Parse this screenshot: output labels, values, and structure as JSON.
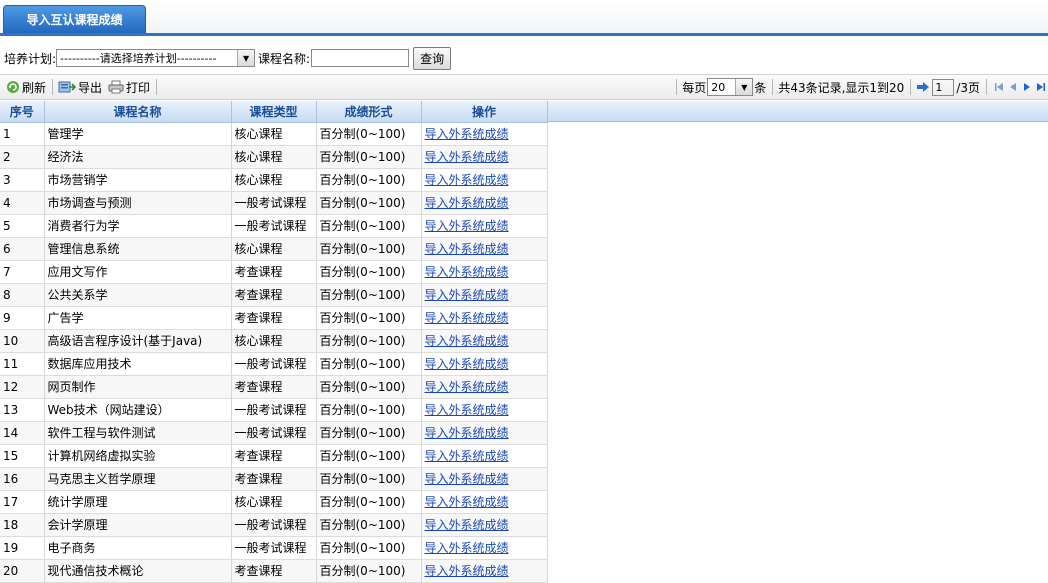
{
  "tab": {
    "label": "导入互认课程成绩"
  },
  "filter": {
    "plan_label": "培养计划:",
    "plan_value": "----------请选择培养计划----------",
    "course_label": "课程名称:",
    "course_value": "",
    "query_button": "查询"
  },
  "toolbar": {
    "refresh": "刷新",
    "export": "导出",
    "print": "打印"
  },
  "pager": {
    "per_page_label": "每页",
    "per_page_value": "20",
    "per_page_unit": "条",
    "summary": "共43条记录,显示1到20",
    "page_value": "1",
    "page_total": "/3页"
  },
  "table": {
    "headers": [
      "序号",
      "课程名称",
      "课程类型",
      "成绩形式",
      "操作"
    ],
    "rows": [
      {
        "idx": "1",
        "name": "管理学",
        "type": "核心课程",
        "form": "百分制(0~100)",
        "action": "导入外系统成绩"
      },
      {
        "idx": "2",
        "name": "经济法",
        "type": "核心课程",
        "form": "百分制(0~100)",
        "action": "导入外系统成绩"
      },
      {
        "idx": "3",
        "name": "市场营销学",
        "type": "核心课程",
        "form": "百分制(0~100)",
        "action": "导入外系统成绩"
      },
      {
        "idx": "4",
        "name": "市场调查与预测",
        "type": "一般考试课程",
        "form": "百分制(0~100)",
        "action": "导入外系统成绩"
      },
      {
        "idx": "5",
        "name": "消费者行为学",
        "type": "一般考试课程",
        "form": "百分制(0~100)",
        "action": "导入外系统成绩"
      },
      {
        "idx": "6",
        "name": "管理信息系统",
        "type": "核心课程",
        "form": "百分制(0~100)",
        "action": "导入外系统成绩"
      },
      {
        "idx": "7",
        "name": "应用文写作",
        "type": "考查课程",
        "form": "百分制(0~100)",
        "action": "导入外系统成绩"
      },
      {
        "idx": "8",
        "name": "公共关系学",
        "type": "考查课程",
        "form": "百分制(0~100)",
        "action": "导入外系统成绩"
      },
      {
        "idx": "9",
        "name": "广告学",
        "type": "考查课程",
        "form": "百分制(0~100)",
        "action": "导入外系统成绩"
      },
      {
        "idx": "10",
        "name": "高级语言程序设计(基于Java)",
        "type": "核心课程",
        "form": "百分制(0~100)",
        "action": "导入外系统成绩"
      },
      {
        "idx": "11",
        "name": "数据库应用技术",
        "type": "一般考试课程",
        "form": "百分制(0~100)",
        "action": "导入外系统成绩"
      },
      {
        "idx": "12",
        "name": "网页制作",
        "type": "考查课程",
        "form": "百分制(0~100)",
        "action": "导入外系统成绩"
      },
      {
        "idx": "13",
        "name": "Web技术（网站建设）",
        "type": "一般考试课程",
        "form": "百分制(0~100)",
        "action": "导入外系统成绩"
      },
      {
        "idx": "14",
        "name": "软件工程与软件测试",
        "type": "一般考试课程",
        "form": "百分制(0~100)",
        "action": "导入外系统成绩"
      },
      {
        "idx": "15",
        "name": "计算机网络虚拟实验",
        "type": "考查课程",
        "form": "百分制(0~100)",
        "action": "导入外系统成绩"
      },
      {
        "idx": "16",
        "name": "马克思主义哲学原理",
        "type": "考查课程",
        "form": "百分制(0~100)",
        "action": "导入外系统成绩"
      },
      {
        "idx": "17",
        "name": "统计学原理",
        "type": "核心课程",
        "form": "百分制(0~100)",
        "action": "导入外系统成绩"
      },
      {
        "idx": "18",
        "name": "会计学原理",
        "type": "一般考试课程",
        "form": "百分制(0~100)",
        "action": "导入外系统成绩"
      },
      {
        "idx": "19",
        "name": "电子商务",
        "type": "一般考试课程",
        "form": "百分制(0~100)",
        "action": "导入外系统成绩"
      },
      {
        "idx": "20",
        "name": "现代通信技术概论",
        "type": "考查课程",
        "form": "百分制(0~100)",
        "action": "导入外系统成绩"
      }
    ]
  },
  "colors": {
    "tab_blue": "#2f73c8",
    "header_text": "#1b4f96",
    "link": "#1a47b8"
  }
}
